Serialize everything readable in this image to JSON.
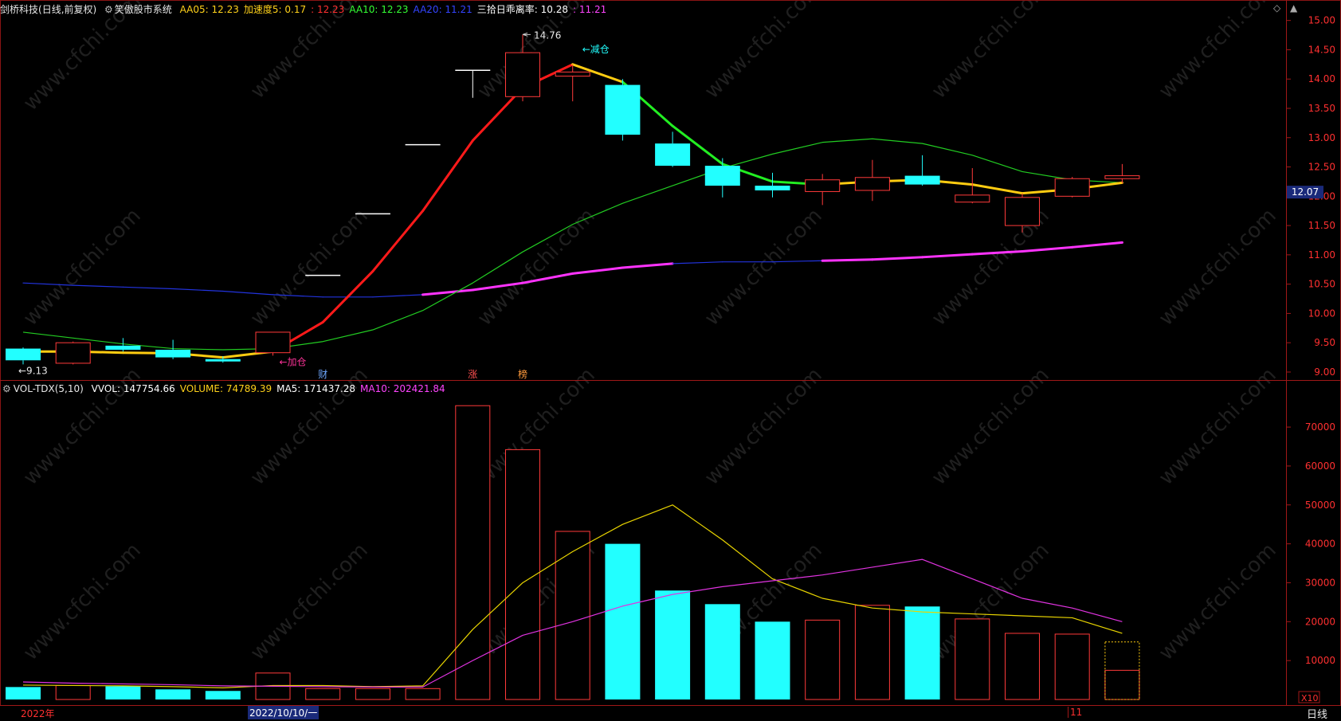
{
  "header": {
    "stock_name": "剑桥科技",
    "period": "(日线,前复权)",
    "system_name": "笑傲股市系统",
    "indicators": [
      {
        "label": "AA05:",
        "value": "12.23",
        "color": "#ffd21a"
      },
      {
        "label": "加速度5:",
        "value": "0.17",
        "color": "#ffd21a"
      },
      {
        "label": ":",
        "value": "12.23",
        "color": "#ff3030"
      },
      {
        "label": "AA10:",
        "value": "12.23",
        "color": "#33ff33"
      },
      {
        "label": "AA20:",
        "value": "11.21",
        "color": "#3344ff"
      },
      {
        "label": "三拾日乖离率:",
        "value": "10.28",
        "color": "#ffffff"
      },
      {
        "label": ":",
        "value": "11.21",
        "color": "#ff44ff"
      }
    ]
  },
  "volume_header": {
    "name": "VOL-TDX(5,10)",
    "items": [
      {
        "label": "VVOL:",
        "value": "147754.66",
        "color": "#ffffff"
      },
      {
        "label": "VOLUME:",
        "value": "74789.39",
        "color": "#ffd21a"
      },
      {
        "label": "MA5:",
        "value": "171437.28",
        "color": "#ffffff"
      },
      {
        "label": "MA10:",
        "value": "202421.84",
        "color": "#ff44ff"
      }
    ]
  },
  "price_axis": [
    "15.00",
    "14.50",
    "14.00",
    "13.50",
    "13.00",
    "12.50",
    "12.00",
    "11.50",
    "11.00",
    "10.50",
    "10.00",
    "9.50",
    "9.00"
  ],
  "price_range": [
    8.85,
    15.05
  ],
  "current_price_tag": "12.07",
  "volume_axis": [
    "70000",
    "60000",
    "50000",
    "40000",
    "30000",
    "20000",
    "10000"
  ],
  "volume_range": [
    0,
    78000
  ],
  "volume_unit": "X10",
  "annotations": {
    "high": "14.76",
    "low": "9.13",
    "reduce": "←减仓",
    "add": "←加仓",
    "marks": [
      {
        "text": "财",
        "bar": 6,
        "color": "#6fa8ff"
      },
      {
        "text": "涨",
        "bar": 9,
        "color": "#ff5050"
      },
      {
        "text": "榜",
        "bar": 10,
        "color": "#ff9a3c"
      }
    ]
  },
  "time_axis": {
    "start": "2022年",
    "date": "2022/10/10/一",
    "month": "11",
    "period_button": "日线"
  },
  "watermark": "www.cfchi.com",
  "chart_data": {
    "type": "candlestick",
    "candles": [
      {
        "o": 9.2,
        "c": 9.4,
        "h": 9.42,
        "l": 9.13,
        "up": false
      },
      {
        "o": 9.15,
        "c": 9.5,
        "h": 9.52,
        "l": 9.13,
        "up": true
      },
      {
        "o": 9.45,
        "c": 9.38,
        "h": 9.58,
        "l": 9.35,
        "up": false
      },
      {
        "o": 9.38,
        "c": 9.25,
        "h": 9.55,
        "l": 9.22,
        "up": false
      },
      {
        "o": 9.22,
        "c": 9.18,
        "h": 9.27,
        "l": 9.16,
        "up": false
      },
      {
        "o": 9.33,
        "c": 9.68,
        "h": 9.68,
        "l": 9.28,
        "up": true
      },
      {
        "o": 10.65,
        "c": 10.65,
        "h": 10.65,
        "l": 10.65,
        "up": true
      },
      {
        "o": 11.7,
        "c": 11.7,
        "h": 11.7,
        "l": 11.7,
        "up": true
      },
      {
        "o": 12.88,
        "c": 12.88,
        "h": 12.88,
        "l": 12.88,
        "up": true
      },
      {
        "o": 14.15,
        "c": 14.15,
        "h": 14.15,
        "l": 13.68,
        "up": true
      },
      {
        "o": 13.7,
        "c": 14.45,
        "h": 14.76,
        "l": 13.62,
        "up": true
      },
      {
        "o": 14.05,
        "c": 14.12,
        "h": 14.25,
        "l": 13.62,
        "up": true
      },
      {
        "o": 13.9,
        "c": 13.05,
        "h": 14.0,
        "l": 12.95,
        "up": false
      },
      {
        "o": 12.9,
        "c": 12.52,
        "h": 13.1,
        "l": 12.5,
        "up": false
      },
      {
        "o": 12.52,
        "c": 12.18,
        "h": 12.65,
        "l": 11.98,
        "up": false
      },
      {
        "o": 12.18,
        "c": 12.1,
        "h": 12.4,
        "l": 11.98,
        "up": false
      },
      {
        "o": 12.08,
        "c": 12.28,
        "h": 12.38,
        "l": 11.85,
        "up": true
      },
      {
        "o": 12.1,
        "c": 12.32,
        "h": 12.62,
        "l": 11.92,
        "up": true
      },
      {
        "o": 12.35,
        "c": 12.2,
        "h": 12.7,
        "l": 12.18,
        "up": false
      },
      {
        "o": 11.9,
        "c": 12.02,
        "h": 12.48,
        "l": 11.88,
        "up": true
      },
      {
        "o": 11.5,
        "c": 11.98,
        "h": 12.05,
        "l": 11.38,
        "up": true
      },
      {
        "o": 12.0,
        "c": 12.3,
        "h": 12.33,
        "l": 11.98,
        "up": true
      },
      {
        "o": 12.3,
        "c": 12.35,
        "h": 12.55,
        "l": 12.22,
        "up": true
      }
    ],
    "aa05": [
      9.35,
      9.35,
      9.33,
      9.32,
      9.25,
      9.35,
      9.85,
      10.72,
      11.75,
      12.95,
      13.85,
      14.25,
      13.95,
      13.2,
      12.55,
      12.25,
      12.2,
      12.25,
      12.28,
      12.2,
      12.05,
      12.12,
      12.23
    ],
    "aa10": [
      9.68,
      9.58,
      9.48,
      9.4,
      9.38,
      9.4,
      9.52,
      9.72,
      10.05,
      10.52,
      11.05,
      11.52,
      11.88,
      12.18,
      12.48,
      12.72,
      12.92,
      12.98,
      12.9,
      12.7,
      12.42,
      12.28,
      12.23
    ],
    "aa20": [
      10.52,
      10.48,
      10.45,
      10.42,
      10.38,
      10.32,
      10.28,
      10.28,
      10.32,
      10.4,
      10.52,
      10.68,
      10.78,
      10.85,
      10.88,
      10.88,
      10.9,
      10.92,
      10.96,
      11.01,
      11.06,
      11.13,
      11.21
    ],
    "volume": [
      3200,
      3600,
      3400,
      2600,
      2200,
      6800,
      2800,
      2800,
      2800,
      75500,
      64200,
      43200,
      40000,
      28000,
      24500,
      20000,
      20400,
      24200,
      23900,
      20700,
      17000,
      16800,
      7500
    ],
    "volume_dotted_last": 14800,
    "volume_up": [
      false,
      true,
      false,
      false,
      false,
      true,
      true,
      true,
      true,
      true,
      true,
      true,
      false,
      false,
      false,
      false,
      true,
      true,
      false,
      true,
      true,
      true,
      true
    ],
    "vol_ma5": [
      3700,
      3600,
      3500,
      3300,
      3000,
      3600,
      3600,
      3300,
      3500,
      18000,
      30000,
      38000,
      45000,
      50000,
      41000,
      31000,
      26000,
      23500,
      22500,
      22000,
      21500,
      21000,
      17000
    ],
    "vol_ma10": [
      4500,
      4200,
      4000,
      3800,
      3500,
      3400,
      3300,
      3200,
      3200,
      10000,
      16500,
      20000,
      24000,
      27000,
      29000,
      30500,
      32000,
      34000,
      36000,
      31000,
      26000,
      23500,
      20000
    ]
  }
}
